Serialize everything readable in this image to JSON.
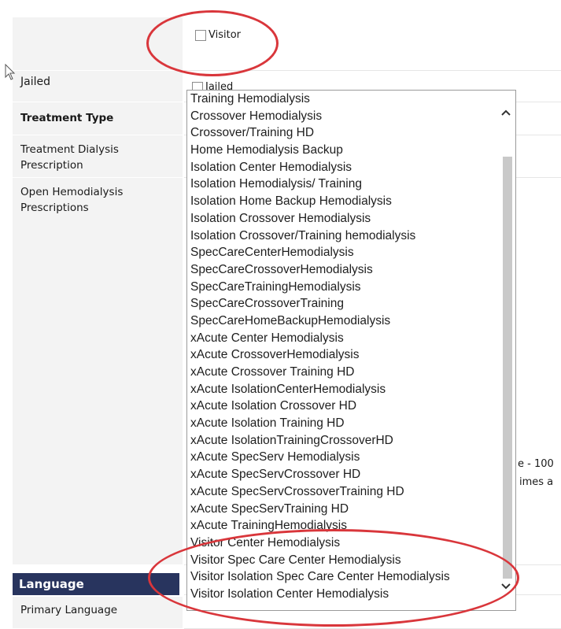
{
  "rows": {
    "visitor": {
      "checkbox_label": "Visitor"
    },
    "jailed": {
      "label": "Jailed",
      "checkbox_label": "Jailed"
    },
    "treatment_type": {
      "label": "Treatment Type"
    },
    "treatment_dialysis_prescription": {
      "label": "Treatment Dialysis Prescription"
    },
    "open_hemodialysis_prescriptions": {
      "label": "Open Hemodialysis Prescriptions"
    }
  },
  "cut_off_text": {
    "line1": "e - 100",
    "line2": "imes a"
  },
  "language_section": {
    "header": "Language",
    "primary_language_label": "Primary Language"
  },
  "dropdown": {
    "options": [
      "Training Hemodialysis",
      "Crossover Hemodialysis",
      "Crossover/Training HD",
      "Home Hemodialysis Backup",
      "Isolation Center Hemodialysis",
      "Isolation Hemodialysis/ Training",
      "Isolation Home Backup Hemodialysis",
      "Isolation Crossover Hemodialysis",
      "Isolation Crossover/Training hemodialysis",
      "SpecCareCenterHemodialysis",
      "SpecCareCrossoverHemodialysis",
      "SpecCareTrainingHemodialysis",
      "SpecCareCrossoverTraining",
      "SpecCareHomeBackupHemodialysis",
      "xAcute Center Hemodialysis",
      "xAcute CrossoverHemodialysis",
      "xAcute Crossover Training HD",
      "xAcute IsolationCenterHemodialysis",
      "xAcute Isolation Crossover HD",
      "xAcute Isolation Training HD",
      "xAcute IsolationTrainingCrossoverHD",
      "xAcute SpecServ Hemodialysis",
      "xAcute SpecServCrossover HD",
      "xAcute SpecServCrossoverTraining HD",
      "xAcute SpecServTraining HD",
      "xAcute TrainingHemodialysis",
      "Visitor Center Hemodialysis",
      "Visitor Spec Care Center Hemodialysis",
      "Visitor Isolation Spec Care Center Hemodialysis",
      "Visitor Isolation Center Hemodialysis"
    ],
    "scroll_position": 0.08
  },
  "colors": {
    "annotation": "#d9363b",
    "section_header_bg": "#28345e",
    "label_bg": "#f3f3f3"
  },
  "icons": {
    "cursor": "mouse-pointer-icon",
    "scroll_up": "chevron-up-icon",
    "scroll_down": "chevron-down-icon"
  }
}
